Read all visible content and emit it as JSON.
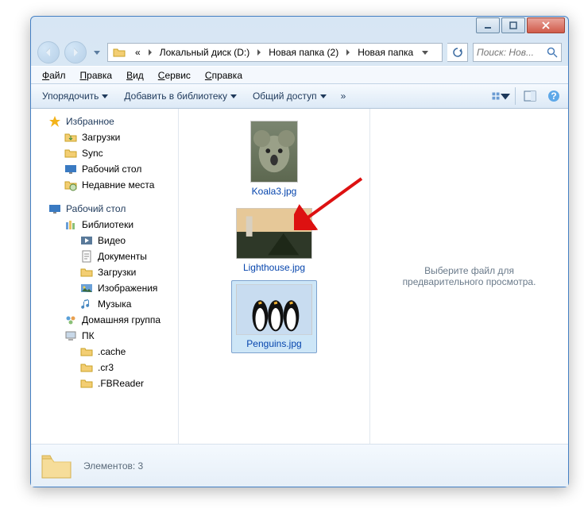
{
  "titlebar": {},
  "address": {
    "segments": [
      "Локальный диск (D:)",
      "Новая папка (2)",
      "Новая папка"
    ],
    "prefix": "«"
  },
  "search": {
    "placeholder": "Поиск: Нов..."
  },
  "menu": {
    "file": "Файл",
    "edit": "Правка",
    "view": "Вид",
    "tools": "Сервис",
    "help": "Справка"
  },
  "toolbar": {
    "organize": "Упорядочить",
    "add_library": "Добавить в библиотеку",
    "share": "Общий доступ",
    "overflow": "»"
  },
  "sidebar": {
    "favorites": "Избранное",
    "fav_items": [
      "Загрузки",
      "Sync",
      "Рабочий стол",
      "Недавние места"
    ],
    "desktop": "Рабочий стол",
    "libraries": "Библиотеки",
    "lib_items": [
      "Видео",
      "Документы",
      "Загрузки",
      "Изображения",
      "Музыка"
    ],
    "homegroup": "Домашняя группа",
    "pc": "ПК",
    "pc_items": [
      ".cache",
      ".cr3",
      ".FBReader"
    ]
  },
  "files": {
    "items": [
      {
        "name": "Koala3.jpg",
        "selected": false,
        "thumb": "koala"
      },
      {
        "name": "Lighthouse.jpg",
        "selected": false,
        "thumb": "light"
      },
      {
        "name": "Penguins.jpg",
        "selected": true,
        "thumb": "peng"
      }
    ]
  },
  "preview": {
    "empty_text": "Выберите файл для предварительного просмотра."
  },
  "details": {
    "count_label": "Элементов: 3"
  }
}
